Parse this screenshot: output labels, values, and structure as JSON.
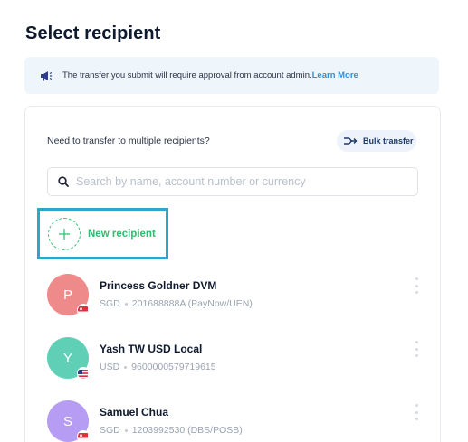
{
  "page": {
    "title": "Select recipient"
  },
  "banner": {
    "message": "The transfer you submit will require approval from account admin.",
    "link": "Learn More",
    "icon": "megaphone-icon"
  },
  "card": {
    "multi_text": "Need to transfer to multiple recipients?",
    "bulk_button": "Bulk transfer",
    "search": {
      "placeholder": "Search by name, account number or currency",
      "value": ""
    },
    "new_recipient": "New recipient",
    "recipients": [
      {
        "initial": "P",
        "name": "Princess Goldner DVM",
        "currency": "SGD",
        "account": "201688888A (PayNow/UEN)",
        "avatar_color": "#ef8a8a",
        "flag": "sg-flag-icon"
      },
      {
        "initial": "Y",
        "name": "Yash TW USD Local",
        "currency": "USD",
        "account": "9600000579719615",
        "avatar_color": "#5fd0b6",
        "flag": "us-flag-icon"
      },
      {
        "initial": "S",
        "name": "Samuel Chua",
        "currency": "SGD",
        "account": "1203992530 (DBS/POSB)",
        "avatar_color": "#b69cf2",
        "flag": "sg-flag-icon"
      }
    ]
  },
  "colors": {
    "accent_green": "#2ebd6f",
    "focus_border": "#2da6c9",
    "link_blue": "#2f8fde",
    "banner_bg": "#eef6fc"
  }
}
